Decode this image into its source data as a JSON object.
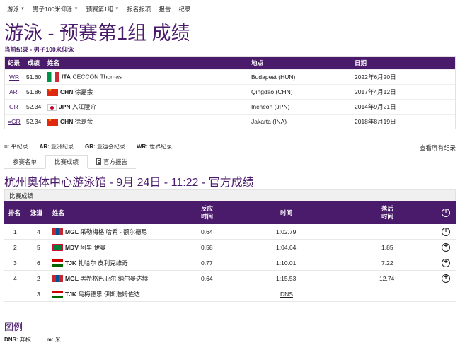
{
  "nav": [
    {
      "label": "游泳",
      "dropdown": true
    },
    {
      "label": "男子100米仰泳",
      "dropdown": true
    },
    {
      "label": "预赛第1组",
      "dropdown": true
    },
    {
      "label": "报名报项",
      "dropdown": false
    },
    {
      "label": "报告",
      "dropdown": false
    },
    {
      "label": "纪录",
      "dropdown": false
    }
  ],
  "page_title": "游泳 - 预赛第1组 成绩",
  "records": {
    "caption": "当前纪录 - 男子100米仰泳",
    "headers": {
      "record": "纪录",
      "result": "成绩",
      "name": "姓名",
      "place": "地点",
      "date": "日期"
    },
    "rows": [
      {
        "code": "WR",
        "result": "51.60",
        "flag": "ita",
        "noc": "ITA",
        "name": "CECCON Thomas",
        "place": "Budapest (HUN)",
        "date": "2022年6月20日"
      },
      {
        "code": "AR",
        "result": "51.86",
        "flag": "chn",
        "noc": "CHN",
        "name": "徐嘉余",
        "place": "Qingdao (CHN)",
        "date": "2017年4月12日"
      },
      {
        "code": "GR",
        "result": "52.34",
        "flag": "jpn",
        "noc": "JPN",
        "name": "入江陵介",
        "place": "Incheon (JPN)",
        "date": "2014年9月21日"
      },
      {
        "code": "=GR",
        "result": "52.34",
        "flag": "chn",
        "noc": "CHN",
        "name": "徐嘉余",
        "place": "Jakarta (INA)",
        "date": "2018年8月19日"
      }
    ]
  },
  "record_legend": [
    {
      "code": "=:",
      "text": "平纪录"
    },
    {
      "code": "AR:",
      "text": "亚洲纪录"
    },
    {
      "code": "GR:",
      "text": "亚运会纪录"
    },
    {
      "code": "WR:",
      "text": "世界纪录"
    }
  ],
  "view_all_records": "查看所有纪录",
  "tabs": [
    {
      "label": "参赛名单",
      "active": false
    },
    {
      "label": "比赛成绩",
      "active": true
    },
    {
      "label": "官方报告",
      "active": false
    }
  ],
  "venue_title": "杭州奥体中心游泳馆 - 9月 24日 - 11:22 - 官方成绩",
  "results": {
    "caption": "比赛成绩",
    "headers": {
      "rank": "排名",
      "lane": "泳道",
      "name": "姓名",
      "reaction_l1": "反应",
      "reaction_l2": "时间",
      "time": "时间",
      "behind_l1": "落后",
      "behind_l2": "时间"
    },
    "rows": [
      {
        "rank": "1",
        "lane": "4",
        "flag": "mgl",
        "noc": "MGL",
        "name": "采勒梅格 哈希 - 额尔德尼",
        "reaction": "0.64",
        "time": "1:02.79",
        "behind": ""
      },
      {
        "rank": "2",
        "lane": "5",
        "flag": "mdv",
        "noc": "MDV",
        "name": "阿里 伊曼",
        "reaction": "0.58",
        "time": "1:04.64",
        "behind": "1.85"
      },
      {
        "rank": "3",
        "lane": "6",
        "flag": "tjk",
        "noc": "TJK",
        "name": "扎哈尔 皮利克维奇",
        "reaction": "0.77",
        "time": "1:10.01",
        "behind": "7.22"
      },
      {
        "rank": "4",
        "lane": "2",
        "flag": "mgl",
        "noc": "MGL",
        "name": "黑希格巴亚尔 纳尔曼达赫",
        "reaction": "0.64",
        "time": "1:15.53",
        "behind": "12.74"
      },
      {
        "rank": "",
        "lane": "3",
        "flag": "tjk",
        "noc": "TJK",
        "name": "乌梅德思 伊斯浩姆佐达",
        "reaction": "",
        "time": "DNS",
        "behind": ""
      }
    ]
  },
  "legend_title": "图例",
  "legend_items": [
    {
      "code": "DNS:",
      "text": "弃权"
    },
    {
      "code": "m:",
      "text": "米"
    }
  ]
}
